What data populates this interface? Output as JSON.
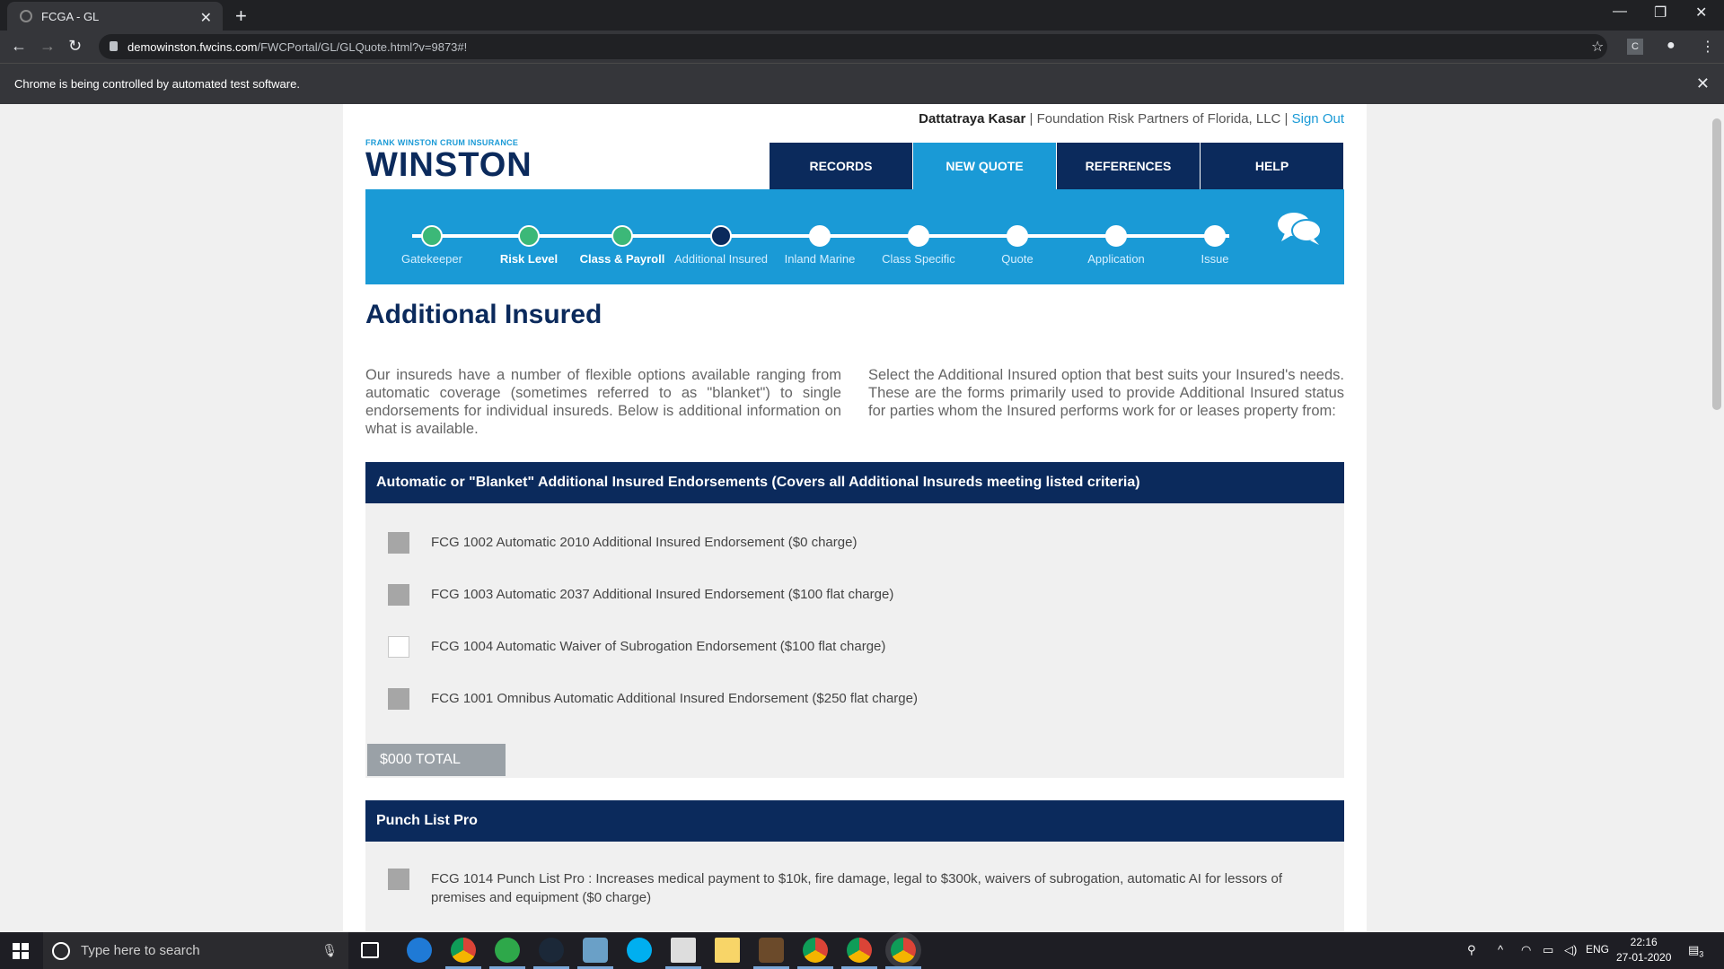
{
  "browser": {
    "tab_title": "FCGA - GL",
    "url_host": "demowinston.fwcins.com",
    "url_path": "/FWCPortal/GL/GLQuote.html?v=9873#!",
    "infobar_text": "Chrome is being controlled by automated test software."
  },
  "header": {
    "user_name": "Dattatraya Kasar",
    "agency": "Foundation Risk Partners of Florida, LLC",
    "sign_out": "Sign Out",
    "logo_small": "FRANK WINSTON CRUM INSURANCE",
    "logo_big": "WINSTON"
  },
  "nav": [
    {
      "label": "RECORDS",
      "active": false
    },
    {
      "label": "NEW QUOTE",
      "active": true
    },
    {
      "label": "REFERENCES",
      "active": false
    },
    {
      "label": "HELP",
      "active": false
    }
  ],
  "steps": [
    {
      "label": "Gatekeeper",
      "state": "done"
    },
    {
      "label": "Risk Level",
      "state": "done"
    },
    {
      "label": "Class & Payroll",
      "state": "done"
    },
    {
      "label": "Additional Insured",
      "state": "current"
    },
    {
      "label": "Inland Marine",
      "state": "todo"
    },
    {
      "label": "Class Specific",
      "state": "todo"
    },
    {
      "label": "Quote",
      "state": "todo"
    },
    {
      "label": "Application",
      "state": "todo"
    },
    {
      "label": "Issue",
      "state": "todo"
    }
  ],
  "main": {
    "title": "Additional Insured",
    "intro_left": "Our insureds have a number of flexible options available ranging from automatic coverage (sometimes referred to as \"blanket\") to single endorsements for individual insureds. Below is additional information on what is available.",
    "intro_right": "Select the Additional Insured option that best suits your Insured's needs. These are the forms primarily used to provide Additional Insured status for parties whom the Insured performs work for or leases property from:"
  },
  "blanket_section": {
    "header": "Automatic or \"Blanket\" Additional Insured Endorsements (Covers all Additional Insureds meeting listed criteria)",
    "options": [
      {
        "label": "FCG 1002 Automatic 2010 Additional Insured Endorsement ($0 charge)",
        "state": "disabled"
      },
      {
        "label": "FCG 1003 Automatic 2037 Additional Insured Endorsement ($100 flat charge)",
        "state": "disabled"
      },
      {
        "label": "FCG 1004 Automatic Waiver of Subrogation Endorsement ($100 flat charge)",
        "state": "unchecked"
      },
      {
        "label": "FCG 1001 Omnibus Automatic Additional Insured Endorsement ($250 flat charge)",
        "state": "disabled"
      }
    ],
    "total": "$000 TOTAL"
  },
  "punch_section": {
    "header": "Punch List Pro",
    "options": [
      {
        "label": "FCG 1014 Punch List Pro : Increases medical payment to $10k, fire damage, legal to $300k, waivers of subrogation, automatic AI for lessors of premises and equipment ($0 charge)",
        "state": "disabled"
      }
    ]
  },
  "taskbar": {
    "search_placeholder": "Type here to search",
    "lang": "ENG",
    "time": "22:16",
    "date": "27-01-2020",
    "notif_count": "3"
  }
}
